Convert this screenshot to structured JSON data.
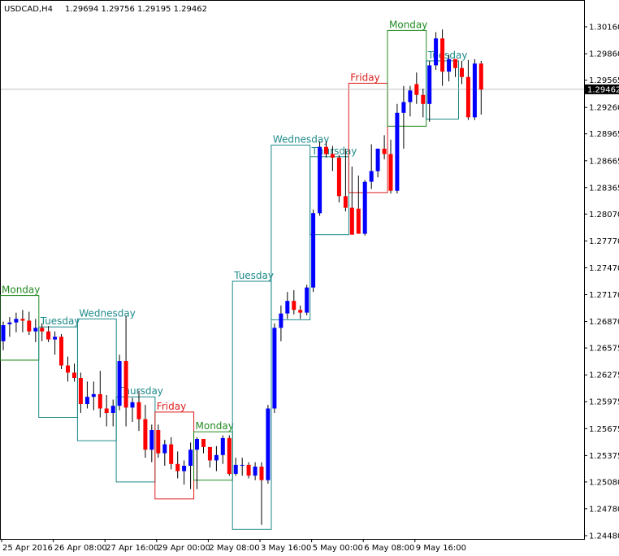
{
  "header": {
    "symbol": "USDCAD,H4",
    "ohlc": "1.29694 1.29756 1.29195 1.29462"
  },
  "current_price": {
    "label": "1.29462",
    "value": 1.29462
  },
  "colors": {
    "bull": "#0000ff",
    "bear": "#ff0000",
    "wick": "#000000",
    "monday": "#218b21",
    "teal": "#1e8a8a",
    "friday": "#dc1e1e",
    "price_line": "#c0c0c0"
  },
  "chart_data": {
    "type": "candlestick",
    "title": "USDCAD,H4",
    "grid": false,
    "ylim": [
      1.2433,
      1.3055
    ],
    "y_ticks": [
      "1.30160",
      "1.29860",
      "1.29565",
      "1.29260",
      "1.28965",
      "1.28665",
      "1.28365",
      "1.28070",
      "1.27770",
      "1.27470",
      "1.27170",
      "1.26870",
      "1.26575",
      "1.26275",
      "1.25975",
      "1.25675",
      "1.25375",
      "1.25080",
      "1.24780",
      "1.24480"
    ],
    "x_ticks": [
      {
        "label": "25 Apr 2016",
        "index": 0
      },
      {
        "label": "26 Apr 08:00",
        "index": 8
      },
      {
        "label": "27 Apr 16:00",
        "index": 16
      },
      {
        "label": "29 Apr 00:00",
        "index": 24
      },
      {
        "label": "2 May 08:00",
        "index": 32
      },
      {
        "label": "3 May 16:00",
        "index": 40
      },
      {
        "label": "5 May 00:00",
        "index": 48
      },
      {
        "label": "6 May 08:00",
        "index": 56
      },
      {
        "label": "9 May 16:00",
        "index": 64
      }
    ],
    "candles": [
      [
        1.2665,
        1.2687,
        1.2655,
        1.2683
      ],
      [
        1.2684,
        1.2692,
        1.267,
        1.2686
      ],
      [
        1.2686,
        1.2697,
        1.2675,
        1.269
      ],
      [
        1.269,
        1.27,
        1.2675,
        1.2688
      ],
      [
        1.2688,
        1.2698,
        1.2672,
        1.2676
      ],
      [
        1.2676,
        1.269,
        1.2664,
        1.268
      ],
      [
        1.268,
        1.2685,
        1.2665,
        1.2676
      ],
      [
        1.2676,
        1.2682,
        1.2664,
        1.2667
      ],
      [
        1.2667,
        1.2676,
        1.265,
        1.267
      ],
      [
        1.267,
        1.2673,
        1.2634,
        1.2638
      ],
      [
        1.2638,
        1.2648,
        1.262,
        1.263
      ],
      [
        1.263,
        1.264,
        1.262,
        1.2624
      ],
      [
        1.2624,
        1.263,
        1.2585,
        1.2595
      ],
      [
        1.2595,
        1.262,
        1.259,
        1.2603
      ],
      [
        1.2603,
        1.262,
        1.2588,
        1.2606
      ],
      [
        1.2606,
        1.2632,
        1.258,
        1.259
      ],
      [
        1.259,
        1.2605,
        1.257,
        1.2585
      ],
      [
        1.2585,
        1.26,
        1.257,
        1.2593
      ],
      [
        1.2593,
        1.265,
        1.2588,
        1.2643
      ],
      [
        1.2643,
        1.2693,
        1.257,
        1.2591
      ],
      [
        1.2591,
        1.2602,
        1.2575,
        1.2597
      ],
      [
        1.2597,
        1.261,
        1.2565,
        1.2578
      ],
      [
        1.2578,
        1.2594,
        1.2535,
        1.2544
      ],
      [
        1.2544,
        1.2572,
        1.253,
        1.2566
      ],
      [
        1.2566,
        1.2572,
        1.2535,
        1.254
      ],
      [
        1.254,
        1.2555,
        1.2526,
        1.255
      ],
      [
        1.255,
        1.2558,
        1.2522,
        1.2528
      ],
      [
        1.2528,
        1.2542,
        1.2512,
        1.252
      ],
      [
        1.252,
        1.2532,
        1.2505,
        1.2526
      ],
      [
        1.2526,
        1.2552,
        1.25,
        1.2544
      ],
      [
        1.2544,
        1.2558,
        1.25,
        1.2556
      ],
      [
        1.2556,
        1.2556,
        1.254,
        1.2547
      ],
      [
        1.2547,
        1.2547,
        1.2524,
        1.2532
      ],
      [
        1.2532,
        1.2548,
        1.252,
        1.2538
      ],
      [
        1.2538,
        1.256,
        1.2528,
        1.2557
      ],
      [
        1.2557,
        1.256,
        1.2515,
        1.2517
      ],
      [
        1.2517,
        1.2535,
        1.2515,
        1.2527
      ],
      [
        1.2527,
        1.2535,
        1.2515,
        1.2527
      ],
      [
        1.2527,
        1.253,
        1.2512,
        1.2515
      ],
      [
        1.2515,
        1.253,
        1.251,
        1.2525
      ],
      [
        1.2525,
        1.253,
        1.246,
        1.251
      ],
      [
        1.251,
        1.2594,
        1.2506,
        1.259
      ],
      [
        1.259,
        1.2685,
        1.2585,
        1.268
      ],
      [
        1.268,
        1.2705,
        1.2665,
        1.2696
      ],
      [
        1.2696,
        1.272,
        1.269,
        1.271
      ],
      [
        1.271,
        1.2722,
        1.2695,
        1.27
      ],
      [
        1.27,
        1.2705,
        1.269,
        1.2697
      ],
      [
        1.2697,
        1.2728,
        1.2694,
        1.2725
      ],
      [
        1.2725,
        1.2812,
        1.272,
        1.2808
      ],
      [
        1.2808,
        1.2888,
        1.2805,
        1.2882
      ],
      [
        1.2882,
        1.2888,
        1.287,
        1.2874
      ],
      [
        1.2874,
        1.2883,
        1.2855,
        1.287
      ],
      [
        1.287,
        1.2873,
        1.282,
        1.2827
      ],
      [
        1.2827,
        1.288,
        1.281,
        1.2814
      ],
      [
        1.2814,
        1.286,
        1.2805,
        1.2784
      ],
      [
        1.2813,
        1.285,
        1.279,
        1.2785
      ],
      [
        1.2785,
        1.2845,
        1.2783,
        1.2843
      ],
      [
        1.2843,
        1.2885,
        1.2835,
        1.2855
      ],
      [
        1.2855,
        1.288,
        1.2848,
        1.288
      ],
      [
        1.288,
        1.2895,
        1.2868,
        1.2874
      ],
      [
        1.2874,
        1.289,
        1.283,
        1.2833
      ],
      [
        1.2833,
        1.293,
        1.283,
        1.292
      ],
      [
        1.292,
        1.295,
        1.288,
        1.2932
      ],
      [
        1.2932,
        1.295,
        1.2916,
        1.2945
      ],
      [
        1.2952,
        1.2965,
        1.293,
        1.294
      ],
      [
        1.294,
        1.2947,
        1.2915,
        1.293
      ],
      [
        1.293,
        1.2978,
        1.291,
        1.2973
      ],
      [
        1.2973,
        1.301,
        1.2968,
        1.3003
      ],
      [
        1.3003,
        1.3013,
        1.295,
        1.2966
      ],
      [
        1.2966,
        1.2985,
        1.2955,
        1.298
      ],
      [
        1.298,
        1.298,
        1.296,
        1.297
      ],
      [
        1.297,
        1.2978,
        1.2952,
        1.296
      ],
      [
        1.296,
        1.2979,
        1.2912,
        1.2915
      ],
      [
        1.2915,
        1.298,
        1.2912,
        1.2975
      ],
      [
        1.2975,
        1.2978,
        1.2918,
        1.2946
      ]
    ],
    "day_boxes": [
      {
        "label": "Monday",
        "start": 0,
        "end": 5,
        "high": 1.2716,
        "low": 1.2644,
        "color": "monday"
      },
      {
        "label": "Tuesday",
        "start": 6,
        "end": 11,
        "high": 1.2681,
        "low": 1.258,
        "color": "teal"
      },
      {
        "label": "Wednesday",
        "start": 12,
        "end": 17,
        "high": 1.269,
        "low": 1.2554,
        "color": "teal"
      },
      {
        "label": "Thursday",
        "start": 18,
        "end": 23,
        "high": 1.2603,
        "low": 1.2508,
        "color": "teal"
      },
      {
        "label": "Friday",
        "start": 24,
        "end": 29,
        "high": 1.2586,
        "low": 1.2489,
        "color": "friday"
      },
      {
        "label": "Monday",
        "start": 30,
        "end": 35,
        "high": 1.2564,
        "low": 1.251,
        "color": "monday"
      },
      {
        "label": "Tuesday",
        "start": 36,
        "end": 41,
        "high": 1.2732,
        "low": 1.2455,
        "color": "teal"
      },
      {
        "label": "Wednesday",
        "start": 42,
        "end": 47,
        "high": 1.2884,
        "low": 1.2689,
        "color": "teal"
      },
      {
        "label": "Thursday",
        "start": 48,
        "end": 53,
        "high": 1.2871,
        "low": 1.2784,
        "color": "teal"
      },
      {
        "label": "Friday",
        "start": 54,
        "end": 59,
        "high": 1.2953,
        "low": 1.2831,
        "color": "friday"
      },
      {
        "label": "Monday",
        "start": 60,
        "end": 65,
        "high": 1.3012,
        "low": 1.2905,
        "color": "monday"
      },
      {
        "label": "Tuesday",
        "start": 66,
        "end": 70,
        "high": 1.2978,
        "low": 1.2913,
        "color": "teal"
      }
    ]
  }
}
